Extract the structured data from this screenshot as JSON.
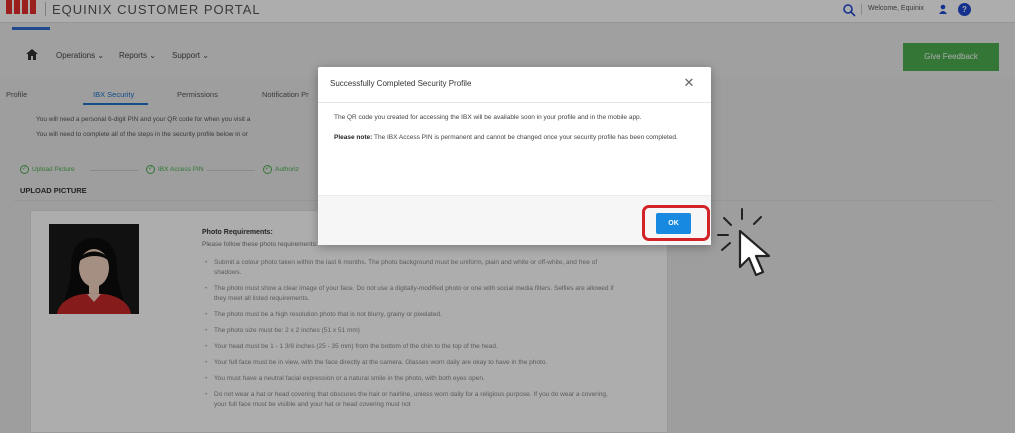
{
  "header": {
    "brand": "EQUINIX CUSTOMER PORTAL",
    "welcome": "Welcome, Equinix",
    "help_label": "?"
  },
  "nav": {
    "items": [
      "Operations",
      "Reports",
      "Support"
    ],
    "feedback_label": "Give Feedback"
  },
  "tabs": [
    "Profile",
    "IBX Security",
    "Permissions",
    "Notification Pr"
  ],
  "info": [
    "You will need a personal 6-digit PIN and your QR code for when you visit a",
    "You will need to complete all of the steps in the security profile below in or"
  ],
  "steps": [
    "Upload Picture",
    "IBX Access PIN",
    "Authoriz"
  ],
  "upload_title": "UPLOAD PICTURE",
  "requirements": {
    "title": "Photo Requirements:",
    "intro": "Please follow these photo requirements:",
    "items": [
      "Submit a colour photo taken within the last 6 months. The photo background must be uniform, plain and white or off-white, and free of shadows.",
      "The photo must show a clear image of your face. Do not use a digitally-modified photo or one with social media filters. Selfies are allowed if they meet all listed requirements.",
      "The photo must be a high resolution photo that is not blurry, grainy or pixelated.",
      "The photo size must be: 2 x 2 inches (51 x 51 mm)",
      "Your head must be 1 - 1 3/8 inches (25 - 35 mm) from the bottom of the chin to the top of the head.",
      "Your full face must be in view, with the face directly at the camera. Glasses worn daily are okay to have in the photo.",
      "You must have a neutral facial expression or a natural smile in the photo, with both eyes open.",
      "Do not wear a hat or head covering that obscures the hair or hairline, unless worn daily for a religious purpose. If you do wear a covering, your full face must be visible and your hat or head covering must not"
    ]
  },
  "modal": {
    "title": "Successfully Completed Security Profile",
    "body": "The QR code you created for accessing the IBX will be available soon in your profile and in the mobile app.",
    "note_label": "Please note:",
    "note": " The IBX Access PIN is permanent and cannot be changed once your security profile has been completed.",
    "ok_label": "OK"
  },
  "colors": {
    "brand_red": "#e5302b",
    "accent_blue": "#1789e0",
    "feedback_green": "#4caf50",
    "highlight_red": "#d32228"
  }
}
